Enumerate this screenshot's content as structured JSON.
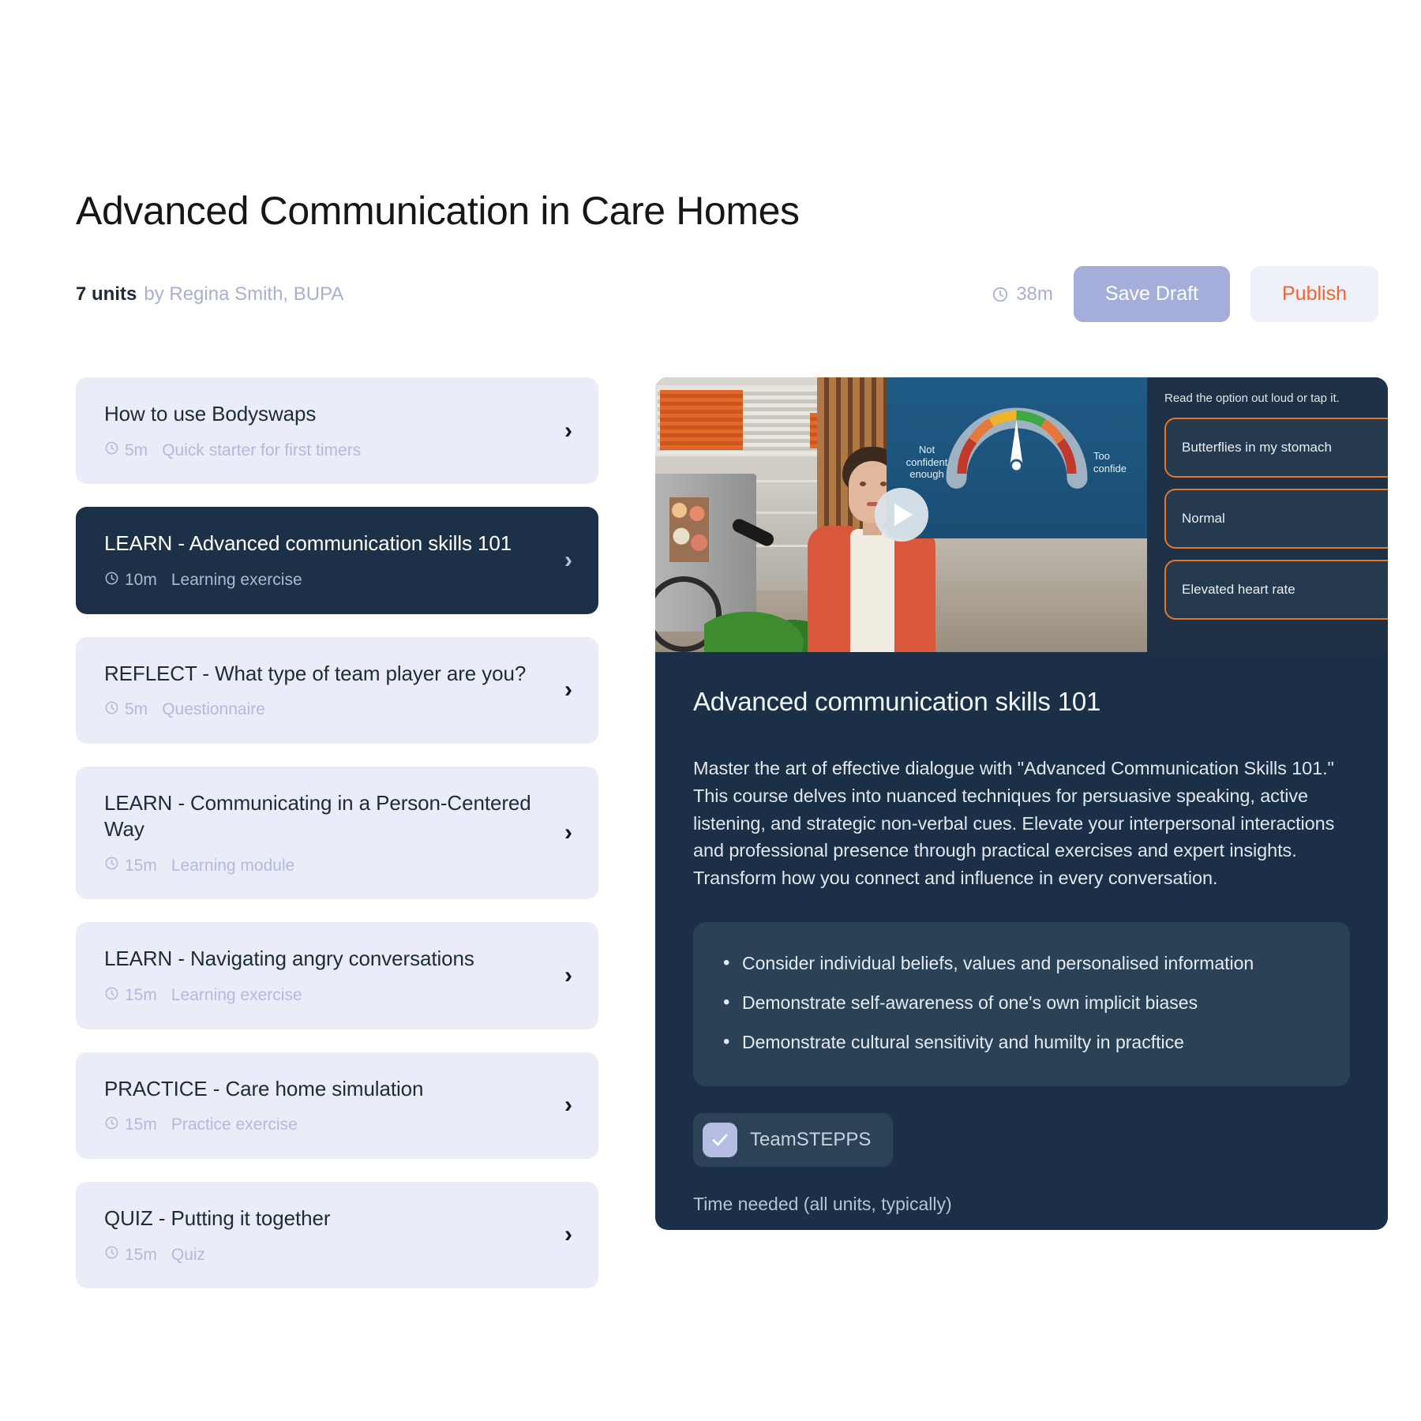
{
  "header": {
    "title": "Advanced Communication in Care Homes",
    "units_count": "7 units",
    "author": "by Regina Smith, BUPA",
    "total_duration": "38m",
    "save_label": "Save Draft",
    "publish_label": "Publish",
    "clock_icon": "clock-icon"
  },
  "units": [
    {
      "name": "How to use Bodyswaps",
      "duration": "5m",
      "type": "Quick starter for first timers",
      "active": false,
      "chevron": "chevron-right-icon"
    },
    {
      "name": "LEARN - Advanced communication skills 101",
      "duration": "10m",
      "type": "Learning exercise",
      "active": true,
      "chevron": "chevron-right-icon"
    },
    {
      "name": "REFLECT - What type of team player are you?",
      "duration": "5m",
      "type": "Questionnaire",
      "active": false,
      "chevron": "chevron-right-icon"
    },
    {
      "name": "LEARN - Communicating in a Person-Centered Way",
      "duration": "15m",
      "type": "Learning module",
      "active": false,
      "chevron": "chevron-right-icon"
    },
    {
      "name": "LEARN - Navigating angry conversations",
      "duration": "15m",
      "type": "Learning exercise",
      "active": false,
      "chevron": "chevron-right-icon"
    },
    {
      "name": "PRACTICE - Care home simulation",
      "duration": "15m",
      "type": "Practice exercise",
      "active": false,
      "chevron": "chevron-right-icon"
    },
    {
      "name": "QUIZ - Putting it together",
      "duration": "15m",
      "type": "Quiz",
      "active": false,
      "chevron": "chevron-right-icon"
    }
  ],
  "preview": {
    "play_icon": "play-button-icon",
    "gauge_left_label": "Not\nconfident\nenough",
    "gauge_right_label": "Too\nconfide",
    "options_hint": "Read the option out loud or tap it.",
    "options": [
      "Butterflies in my stomach",
      "Normal",
      "Elevated heart rate"
    ]
  },
  "detail": {
    "title": "Advanced communication skills 101",
    "description": "Master the art of effective dialogue with \"Advanced Communication Skills 101.\" This course delves into nuanced techniques for persuasive speaking, active listening, and strategic non-verbal cues. Elevate your interpersonal interactions and professional presence through practical exercises and expert insights. Transform how you connect and influence in every conversation.",
    "bullets": [
      "Consider individual beliefs, values and personalised information",
      "Demonstrate self-awareness of one's own implicit biases",
      "Demonstrate cultural sensitivity and humilty in pracftice"
    ],
    "tag_label": "TeamSTEPPS",
    "tag_check_icon": "check-icon",
    "footer_note": "Time needed (all units, typically)"
  },
  "colors": {
    "accent_orange": "#f4622e",
    "save_button": "#a5adda",
    "card_bg": "#eaedf8",
    "active_card_bg": "#1c3048",
    "panel_bg": "#1b2f46",
    "muted_text": "#b3b9dd"
  }
}
